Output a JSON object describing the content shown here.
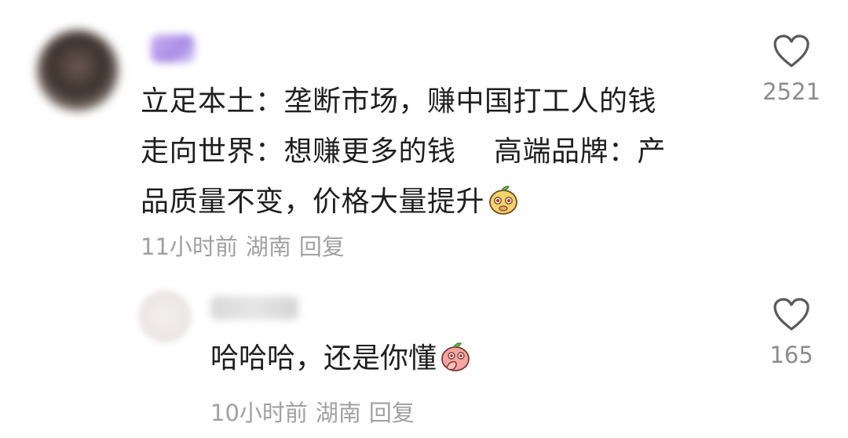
{
  "main_comment": {
    "lines": [
      "立足本土：垄断市场，赚中国打工人的钱",
      "走向世界：想赚更多的钱　 高端品牌：产",
      "品质量不变，价格大量提升"
    ],
    "emoji": "peach-face-emoji",
    "time": "11小时前",
    "location": "湖南",
    "reply_label": "回复",
    "like_count": "2521"
  },
  "reply_comment": {
    "text": "哈哈哈，还是你懂",
    "emoji": "covering-mouth-emoji",
    "time": "10小时前",
    "location": "湖南",
    "reply_label": "回复",
    "like_count": "165"
  },
  "icons": {
    "like": "heart-outline-icon"
  },
  "colors": {
    "text": "#1f1f1f",
    "meta": "#a0a0a0",
    "count": "#8c8c8c"
  }
}
